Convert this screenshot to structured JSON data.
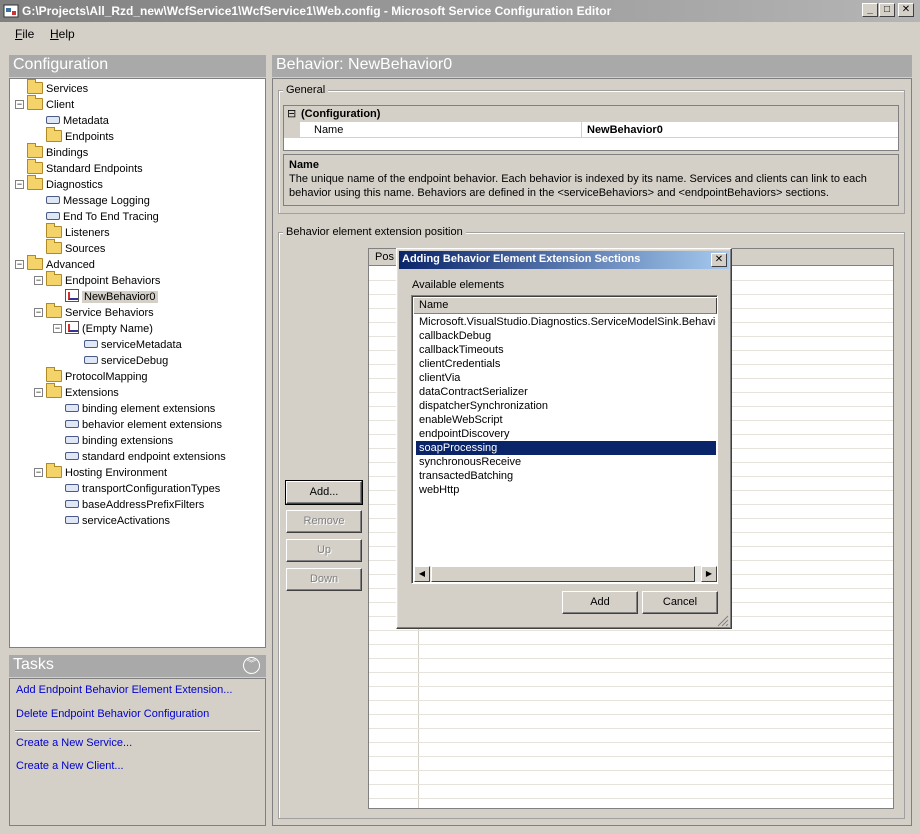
{
  "window": {
    "title": "G:\\Projects\\All_Rzd_new\\WcfService1\\WcfService1\\Web.config - Microsoft Service Configuration Editor",
    "minimize": "_",
    "maximize": "□",
    "close": "✕"
  },
  "menu": [
    {
      "label": "File",
      "accel": "F",
      "rest": "ile"
    },
    {
      "label": "Help",
      "accel": "H",
      "rest": "elp"
    }
  ],
  "config_panel": {
    "title": "Configuration",
    "tree": [
      {
        "label": "Services",
        "icon": "folder-icon",
        "depth": 0,
        "expander": ""
      },
      {
        "label": "Client",
        "icon": "folder-icon",
        "depth": 0,
        "expander": "−"
      },
      {
        "label": "Metadata",
        "icon": "node-icon",
        "depth": 1,
        "expander": ""
      },
      {
        "label": "Endpoints",
        "icon": "folder-icon",
        "depth": 1,
        "expander": ""
      },
      {
        "label": "Bindings",
        "icon": "folder-icon",
        "depth": 0,
        "expander": ""
      },
      {
        "label": "Standard Endpoints",
        "icon": "folder-icon",
        "depth": 0,
        "expander": ""
      },
      {
        "label": "Diagnostics",
        "icon": "folder-icon",
        "depth": 0,
        "expander": "−"
      },
      {
        "label": "Message Logging",
        "icon": "node-icon",
        "depth": 1,
        "expander": ""
      },
      {
        "label": "End To End Tracing",
        "icon": "node-icon",
        "depth": 1,
        "expander": ""
      },
      {
        "label": "Listeners",
        "icon": "folder-icon",
        "depth": 1,
        "expander": ""
      },
      {
        "label": "Sources",
        "icon": "folder-icon",
        "depth": 1,
        "expander": ""
      },
      {
        "label": "Advanced",
        "icon": "folder-icon",
        "depth": 0,
        "expander": "−"
      },
      {
        "label": "Endpoint Behaviors",
        "icon": "folder-icon",
        "depth": 1,
        "expander": "−"
      },
      {
        "label": "NewBehavior0",
        "icon": "behavior-icon",
        "depth": 2,
        "expander": "",
        "selected": true
      },
      {
        "label": "Service Behaviors",
        "icon": "folder-icon",
        "depth": 1,
        "expander": "−"
      },
      {
        "label": "(Empty Name)",
        "icon": "behavior-icon",
        "depth": 2,
        "expander": "−"
      },
      {
        "label": "serviceMetadata",
        "icon": "node-icon",
        "depth": 3,
        "expander": ""
      },
      {
        "label": "serviceDebug",
        "icon": "node-icon",
        "depth": 3,
        "expander": ""
      },
      {
        "label": "ProtocolMapping",
        "icon": "folder-icon",
        "depth": 1,
        "expander": ""
      },
      {
        "label": "Extensions",
        "icon": "folder-icon",
        "depth": 1,
        "expander": "−"
      },
      {
        "label": "binding element extensions",
        "icon": "node-icon",
        "depth": 2,
        "expander": ""
      },
      {
        "label": "behavior element extensions",
        "icon": "node-icon",
        "depth": 2,
        "expander": ""
      },
      {
        "label": "binding extensions",
        "icon": "node-icon",
        "depth": 2,
        "expander": ""
      },
      {
        "label": "standard endpoint extensions",
        "icon": "node-icon",
        "depth": 2,
        "expander": ""
      },
      {
        "label": "Hosting Environment",
        "icon": "folder-icon",
        "depth": 1,
        "expander": "−"
      },
      {
        "label": "transportConfigurationTypes",
        "icon": "node-icon",
        "depth": 2,
        "expander": ""
      },
      {
        "label": "baseAddressPrefixFilters",
        "icon": "node-icon",
        "depth": 2,
        "expander": ""
      },
      {
        "label": "serviceActivations",
        "icon": "node-icon",
        "depth": 2,
        "expander": ""
      }
    ]
  },
  "tasks_panel": {
    "title": "Tasks",
    "chevron": "︾",
    "links": [
      "Add Endpoint Behavior Element Extension...",
      "Delete Endpoint Behavior Configuration",
      "Create a New Service...",
      "Create a New Client..."
    ]
  },
  "behavior_panel": {
    "title": "Behavior: NewBehavior0",
    "general_label": "General",
    "property_grid": {
      "category": "(Configuration)",
      "category_toggle": "⊟",
      "prop_name": "Name",
      "prop_value": "NewBehavior0"
    },
    "description": {
      "title": "Name",
      "text": "The unique name of the endpoint behavior. Each behavior is indexed by its name. Services and clients can link to each behavior using this name. Behaviors are defined in the <serviceBehaviors> and <endpointBehaviors> sections."
    },
    "extension_label": "Behavior element extension position",
    "grid_header": "Pos",
    "buttons": {
      "add": "Add...",
      "remove": "Remove",
      "up": "Up",
      "down": "Down"
    }
  },
  "dialog": {
    "title": "Adding Behavior Element Extension Sections",
    "close": "✕",
    "available_label": "Available elements",
    "column_name": "Name",
    "items": [
      "Microsoft.VisualStudio.Diagnostics.ServiceModelSink.Behavior",
      "callbackDebug",
      "callbackTimeouts",
      "clientCredentials",
      "clientVia",
      "dataContractSerializer",
      "dispatcherSynchronization",
      "enableWebScript",
      "endpointDiscovery",
      "soapProcessing",
      "synchronousReceive",
      "transactedBatching",
      "webHttp"
    ],
    "selected_item": "soapProcessing",
    "scroll_left": "◀",
    "scroll_right": "▶",
    "add_label": "Add",
    "cancel_label": "Cancel"
  }
}
